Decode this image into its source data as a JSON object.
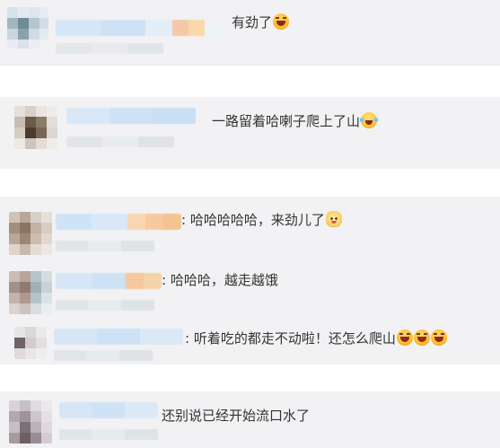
{
  "comments": [
    {
      "text": "有劲了",
      "emojis": [
        "laugh"
      ]
    },
    {
      "text": "一路留着哈喇子爬上了山",
      "emojis": [
        "cry"
      ]
    },
    {
      "text": ": 哈哈哈哈哈，来劲儿了",
      "emojis": [
        "cat"
      ]
    },
    {
      "text": ": 哈哈哈，越走越饿",
      "emojis": []
    },
    {
      "text": ": 听着吃的都走不动啦！还怎么爬山",
      "emojis": [
        "laugh",
        "laugh",
        "laugh"
      ]
    },
    {
      "text": "还别说已经开始流口水了",
      "emojis": []
    }
  ]
}
